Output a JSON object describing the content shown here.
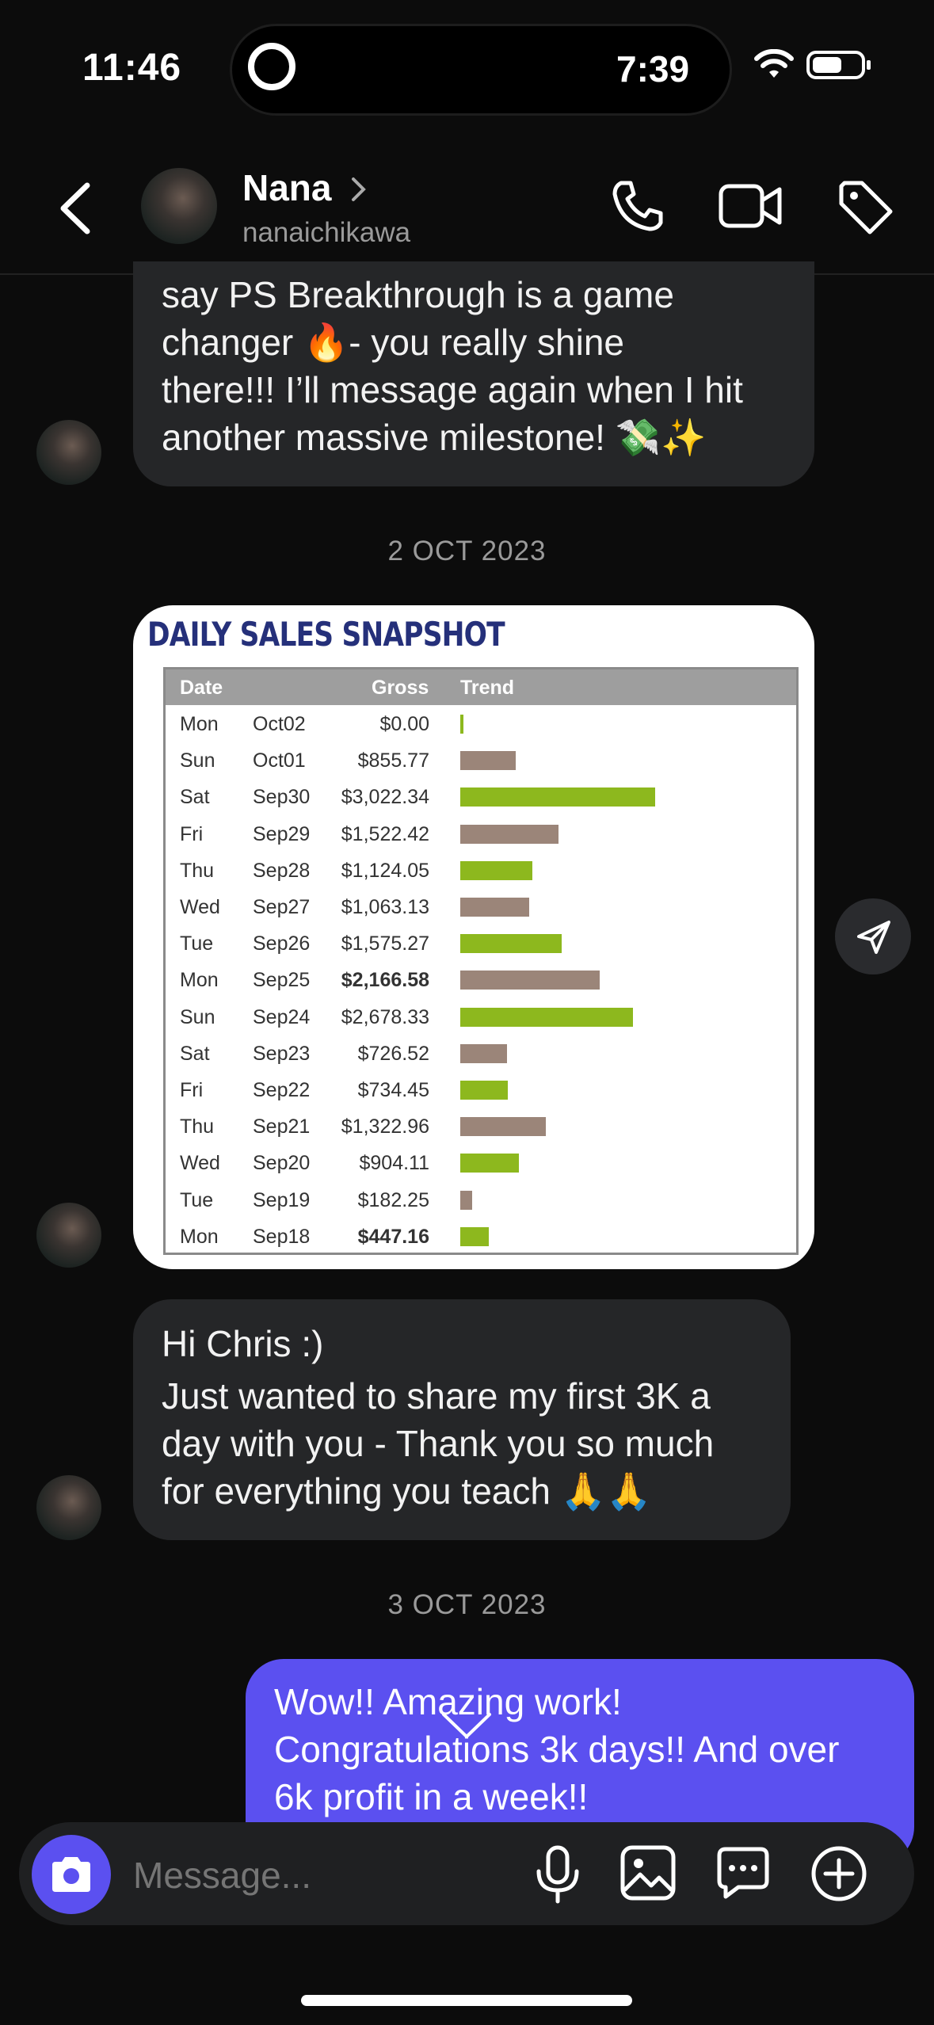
{
  "status": {
    "time": "11:46",
    "island_time": "7:39"
  },
  "header": {
    "name": "Nana",
    "username": "nanaichikawa"
  },
  "messages": {
    "m1_lines": [
      "say PS Breakthrough is a game",
      "changer 🔥- you really shine",
      "there!!! I’ll message again when I hit",
      "another massive milestone! 💸✨"
    ],
    "date1": "2 OCT 2023",
    "m2_lines": [
      "Hi Chris :)",
      "Just wanted to share my first 3K a",
      "day with you - Thank you so much",
      "for everything you teach 🙏🙏"
    ],
    "date2": "3 OCT 2023",
    "out_lines": [
      "Wow!! Amazing work!",
      "Congratulations 3k days!! And over",
      "6k profit in a week!!"
    ]
  },
  "snapshot": {
    "title": "DAILY SALES SNAPSHOT",
    "headers": {
      "date": "Date",
      "gross": "Gross",
      "trend": "Trend"
    },
    "colors": {
      "green": "#8db81e",
      "brown": "#9b8579"
    },
    "rows": [
      {
        "day": "Mon",
        "date": "Oct02",
        "gross": "$0.00",
        "value": 0.0,
        "color": "green",
        "bold": false
      },
      {
        "day": "Sun",
        "date": "Oct01",
        "gross": "$855.77",
        "value": 855.77,
        "color": "brown",
        "bold": false
      },
      {
        "day": "Sat",
        "date": "Sep30",
        "gross": "$3,022.34",
        "value": 3022.34,
        "color": "green",
        "bold": false
      },
      {
        "day": "Fri",
        "date": "Sep29",
        "gross": "$1,522.42",
        "value": 1522.42,
        "color": "brown",
        "bold": false
      },
      {
        "day": "Thu",
        "date": "Sep28",
        "gross": "$1,124.05",
        "value": 1124.05,
        "color": "green",
        "bold": false
      },
      {
        "day": "Wed",
        "date": "Sep27",
        "gross": "$1,063.13",
        "value": 1063.13,
        "color": "brown",
        "bold": false
      },
      {
        "day": "Tue",
        "date": "Sep26",
        "gross": "$1,575.27",
        "value": 1575.27,
        "color": "green",
        "bold": false
      },
      {
        "day": "Mon",
        "date": "Sep25",
        "gross": "$2,166.58",
        "value": 2166.58,
        "color": "brown",
        "bold": true
      },
      {
        "day": "Sun",
        "date": "Sep24",
        "gross": "$2,678.33",
        "value": 2678.33,
        "color": "green",
        "bold": false
      },
      {
        "day": "Sat",
        "date": "Sep23",
        "gross": "$726.52",
        "value": 726.52,
        "color": "brown",
        "bold": false
      },
      {
        "day": "Fri",
        "date": "Sep22",
        "gross": "$734.45",
        "value": 734.45,
        "color": "green",
        "bold": false
      },
      {
        "day": "Thu",
        "date": "Sep21",
        "gross": "$1,322.96",
        "value": 1322.96,
        "color": "brown",
        "bold": false
      },
      {
        "day": "Wed",
        "date": "Sep20",
        "gross": "$904.11",
        "value": 904.11,
        "color": "green",
        "bold": false
      },
      {
        "day": "Tue",
        "date": "Sep19",
        "gross": "$182.25",
        "value": 182.25,
        "color": "brown",
        "bold": false
      },
      {
        "day": "Mon",
        "date": "Sep18",
        "gross": "$447.16",
        "value": 447.16,
        "color": "green",
        "bold": true
      }
    ]
  },
  "composer": {
    "placeholder": "Message..."
  },
  "icons": {
    "back": "chevron-left-icon",
    "call": "phone-icon",
    "video": "video-icon",
    "tag": "tag-icon",
    "send": "send-icon",
    "camera": "camera-icon",
    "mic": "microphone-icon",
    "gallery": "image-icon",
    "sticker": "chat-bubble-icon",
    "plus": "plus-circle-icon"
  }
}
